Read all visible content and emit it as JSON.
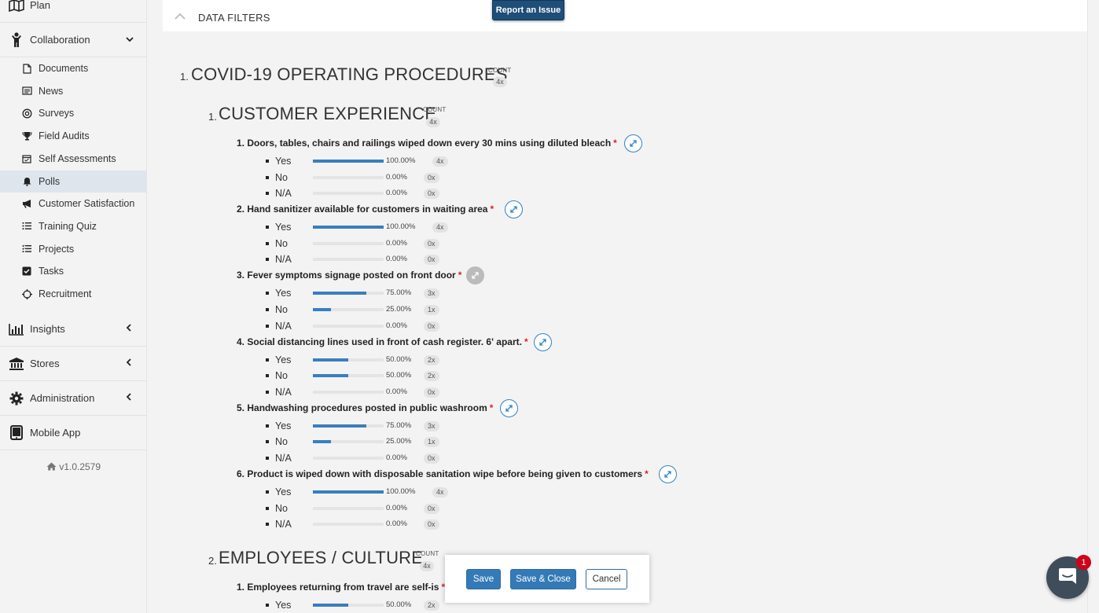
{
  "sidebar": {
    "plan": "Plan",
    "collaboration": "Collaboration",
    "items": [
      {
        "label": "Documents",
        "icon": "document-icon"
      },
      {
        "label": "News",
        "icon": "newspaper-icon"
      },
      {
        "label": "Surveys",
        "icon": "target-icon"
      },
      {
        "label": "Field Audits",
        "icon": "trophy-icon"
      },
      {
        "label": "Self Assessments",
        "icon": "calendar-check-icon"
      },
      {
        "label": "Polls",
        "icon": "bell-icon",
        "active": true
      },
      {
        "label": "Customer Satisfaction",
        "icon": "megaphone-icon"
      },
      {
        "label": "Training Quiz",
        "icon": "list-icon"
      },
      {
        "label": "Projects",
        "icon": "tasks-list-icon"
      },
      {
        "label": "Tasks",
        "icon": "checkbox-icon"
      },
      {
        "label": "Recruitment",
        "icon": "crosshair-icon"
      }
    ],
    "insights": "Insights",
    "stores": "Stores",
    "administration": "Administration",
    "mobile_app": "Mobile App",
    "version": "v1.0.2579"
  },
  "header": {
    "filters_title": "DATA FILTERS",
    "report_issue": "Report an Issue"
  },
  "count_label": "COUNT",
  "sections": [
    {
      "num": "1.",
      "title": "COVID-19 OPERATING PROCEDURES",
      "count": "4x",
      "subsections": [
        {
          "num": "1.",
          "title": "CUSTOMER EXPERIENCE",
          "count": "4x",
          "questions": [
            {
              "num": "1.",
              "text": "Doors, tables, chairs and railings wiped down every 30 mins using diluted bleach",
              "expand_enabled": true,
              "answers": [
                {
                  "label": "Yes",
                  "pct": "100.00%",
                  "frac": 1.0,
                  "count": "4x"
                },
                {
                  "label": "No",
                  "pct": "0.00%",
                  "frac": 0,
                  "count": "0x"
                },
                {
                  "label": "N/A",
                  "pct": "0.00%",
                  "frac": 0,
                  "count": "0x"
                }
              ]
            },
            {
              "num": "2.",
              "text": "Hand sanitizer available for customers in waiting area",
              "expand_enabled": true,
              "answers": [
                {
                  "label": "Yes",
                  "pct": "100.00%",
                  "frac": 1.0,
                  "count": "4x"
                },
                {
                  "label": "No",
                  "pct": "0.00%",
                  "frac": 0,
                  "count": "0x"
                },
                {
                  "label": "N/A",
                  "pct": "0.00%",
                  "frac": 0,
                  "count": "0x"
                }
              ]
            },
            {
              "num": "3.",
              "text": "Fever symptoms signage posted on front door",
              "expand_enabled": false,
              "answers": [
                {
                  "label": "Yes",
                  "pct": "75.00%",
                  "frac": 0.75,
                  "count": "3x"
                },
                {
                  "label": "No",
                  "pct": "25.00%",
                  "frac": 0.25,
                  "count": "1x"
                },
                {
                  "label": "N/A",
                  "pct": "0.00%",
                  "frac": 0,
                  "count": "0x"
                }
              ]
            },
            {
              "num": "4.",
              "text": "Social distancing lines used in front of cash register. 6' apart.",
              "expand_enabled": true,
              "answers": [
                {
                  "label": "Yes",
                  "pct": "50.00%",
                  "frac": 0.5,
                  "count": "2x"
                },
                {
                  "label": "No",
                  "pct": "50.00%",
                  "frac": 0.5,
                  "count": "2x"
                },
                {
                  "label": "N/A",
                  "pct": "0.00%",
                  "frac": 0,
                  "count": "0x"
                }
              ]
            },
            {
              "num": "5.",
              "text": "Handwashing procedures posted in public washroom",
              "expand_enabled": true,
              "answers": [
                {
                  "label": "Yes",
                  "pct": "75.00%",
                  "frac": 0.75,
                  "count": "3x"
                },
                {
                  "label": "No",
                  "pct": "25.00%",
                  "frac": 0.25,
                  "count": "1x"
                },
                {
                  "label": "N/A",
                  "pct": "0.00%",
                  "frac": 0,
                  "count": "0x"
                }
              ]
            },
            {
              "num": "6.",
              "text": "Product is wiped down with disposable sanitation wipe before being given to customers",
              "expand_enabled": true,
              "answers": [
                {
                  "label": "Yes",
                  "pct": "100.00%",
                  "frac": 1.0,
                  "count": "4x"
                },
                {
                  "label": "No",
                  "pct": "0.00%",
                  "frac": 0,
                  "count": "0x"
                },
                {
                  "label": "N/A",
                  "pct": "0.00%",
                  "frac": 0,
                  "count": "0x"
                }
              ]
            }
          ]
        },
        {
          "num": "2.",
          "title": "EMPLOYEES / CULTURE",
          "count": "4x",
          "questions": [
            {
              "num": "1.",
              "text": "Employees returning from travel are self-is",
              "expand_enabled": true,
              "answers": [
                {
                  "label": "Yes",
                  "pct": "50.00%",
                  "frac": 0.5,
                  "count": "2x"
                }
              ]
            }
          ]
        }
      ]
    }
  ],
  "save_panel": {
    "save": "Save",
    "save_close": "Save & Close",
    "cancel": "Cancel"
  },
  "chat": {
    "unread": "1"
  }
}
